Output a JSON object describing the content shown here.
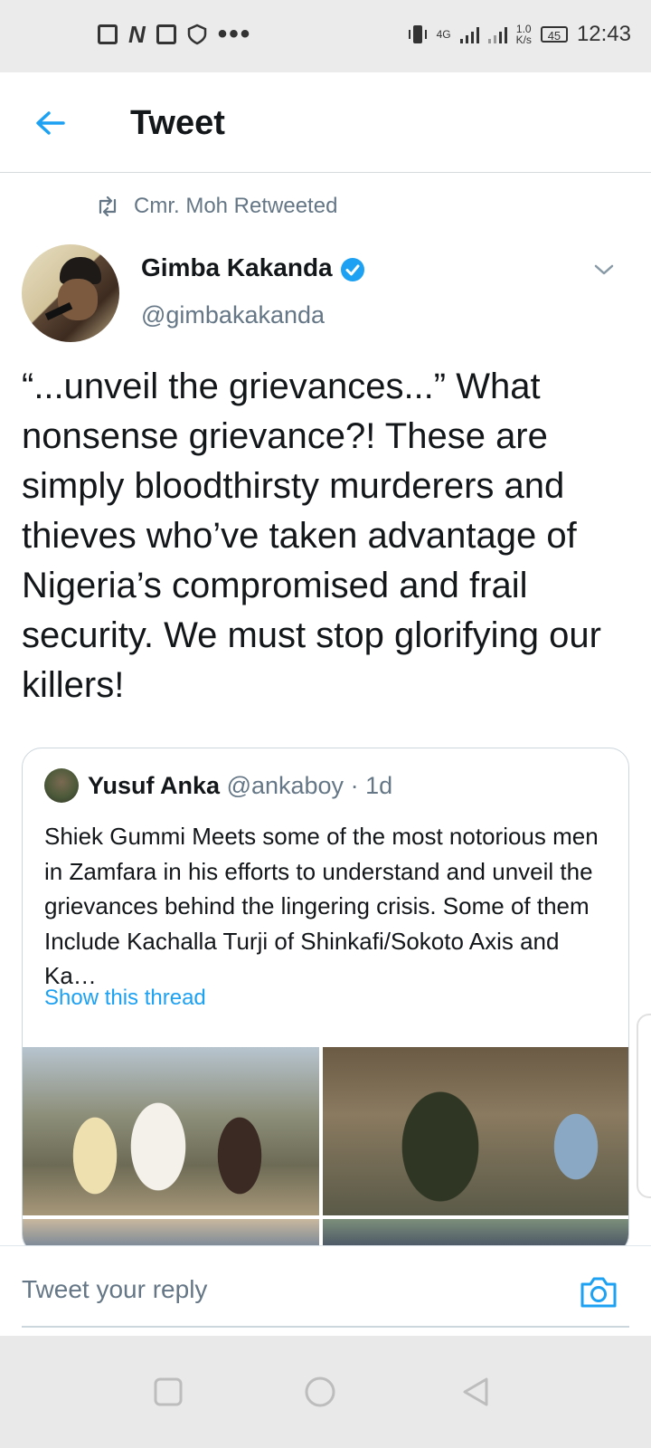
{
  "status_bar": {
    "network_type": "4G",
    "speed_value": "1.0",
    "speed_unit": "K/s",
    "battery": "45",
    "time": "12:43"
  },
  "header": {
    "title": "Tweet"
  },
  "retweet": {
    "text": "Cmr. Moh Retweeted"
  },
  "tweet": {
    "author_name": "Gimba Kakanda",
    "author_handle": "@gimbakakanda",
    "text": "“...unveil the grievances...” What nonsense grievance?! These are simply bloodthirsty murderers and thieves who’ve taken advantage of Nigeria’s compromised and frail security. We must stop glorifying our killers!"
  },
  "quoted_tweet": {
    "author_name": "Yusuf Anka",
    "author_handle": "@ankaboy",
    "time_ago": "· 1d",
    "text": "Shiek Gummi Meets some of the most notorious men in Zamfara in his efforts to understand and unveil the grievances behind the lingering crisis. Some of them Include Kachalla Turji of Shinkafi/Sokoto Axis and Ka…",
    "show_thread": "Show this thread"
  },
  "reply": {
    "placeholder": "Tweet your reply"
  },
  "colors": {
    "accent": "#1da1f2",
    "muted": "#657786",
    "text": "#14171a"
  },
  "icons": [
    "back-arrow-icon",
    "retweet-icon",
    "verified-badge-icon",
    "chevron-down-icon",
    "camera-icon",
    "square-nav-icon",
    "circle-nav-icon",
    "triangle-back-nav-icon"
  ]
}
